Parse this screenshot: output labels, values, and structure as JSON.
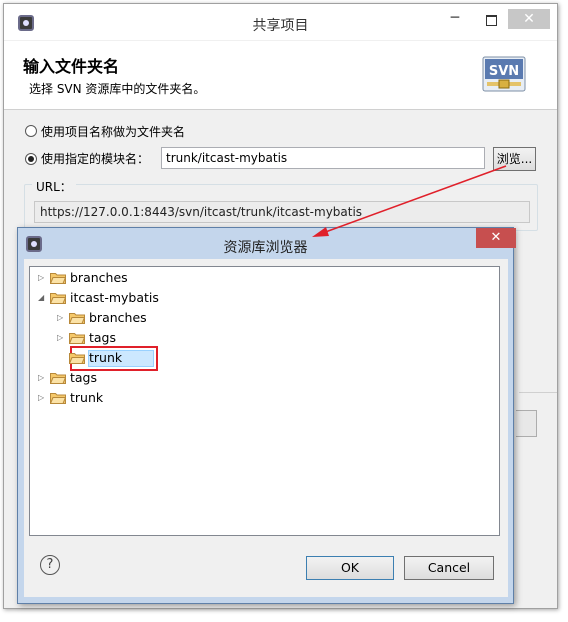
{
  "main_window": {
    "title": "共享项目",
    "minimize_glyph": "─",
    "close_glyph": "✕",
    "header_title": "输入文件夹名",
    "header_desc": "选择 SVN 资源库中的文件夹名。",
    "logo_text": "SVN"
  },
  "options": {
    "use_project_name": "使用项目名称做为文件夹名",
    "use_module_name": "使用指定的模块名：",
    "module_value": "trunk/itcast-mybatis",
    "browse_label": "浏览...",
    "url_label": "URL：",
    "url_value": "https://127.0.0.1:8443/svn/itcast/trunk/itcast-mybatis"
  },
  "repo_browser": {
    "title": "资源库浏览器",
    "close_glyph": "✕",
    "tree": [
      {
        "label": "branches",
        "level": 0,
        "state": "collapsed",
        "selected": false
      },
      {
        "label": "itcast-mybatis",
        "level": 0,
        "state": "expanded",
        "selected": false
      },
      {
        "label": "branches",
        "level": 1,
        "state": "collapsed",
        "selected": false
      },
      {
        "label": "tags",
        "level": 1,
        "state": "collapsed",
        "selected": false
      },
      {
        "label": "trunk",
        "level": 1,
        "state": "leaf",
        "selected": true
      },
      {
        "label": "tags",
        "level": 0,
        "state": "collapsed",
        "selected": false
      },
      {
        "label": "trunk",
        "level": 0,
        "state": "collapsed",
        "selected": false
      }
    ],
    "help_glyph": "?",
    "ok_label": "OK",
    "cancel_label": "Cancel"
  },
  "colors": {
    "annotation_red": "#e0202a",
    "folder_fill": "#f5c86a",
    "dialog_frame": "#c4d6ec"
  },
  "icons": [
    "app-icon",
    "svn-logo-icon",
    "folder-icon",
    "help-icon",
    "close-icon",
    "annotation-arrow"
  ]
}
